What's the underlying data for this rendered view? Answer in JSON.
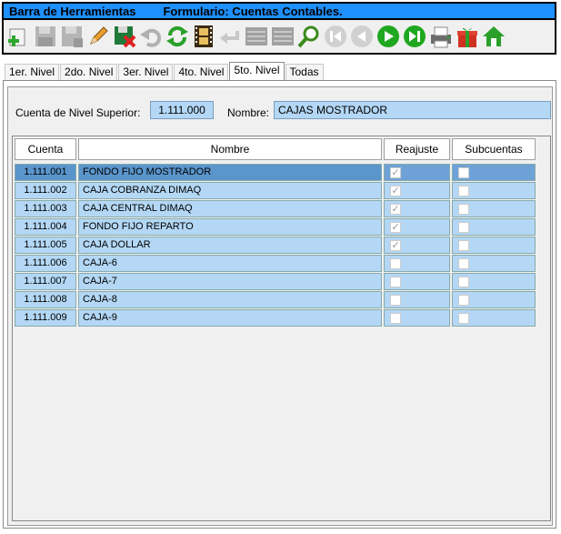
{
  "toolbar": {
    "title": "Barra de Herramientas",
    "subtitle": "Formulario: Cuentas Contables.",
    "buttons": [
      {
        "name": "add-icon"
      },
      {
        "name": "save-icon"
      },
      {
        "name": "save-as-icon"
      },
      {
        "name": "edit-icon"
      },
      {
        "name": "delete-icon"
      },
      {
        "name": "undo-icon"
      },
      {
        "name": "refresh-icon"
      },
      {
        "name": "film-icon"
      },
      {
        "name": "back-arrow-icon"
      },
      {
        "name": "list-icon"
      },
      {
        "name": "list-alt-icon"
      },
      {
        "name": "search-icon"
      },
      {
        "name": "first-icon"
      },
      {
        "name": "previous-icon"
      },
      {
        "name": "next-icon"
      },
      {
        "name": "last-icon"
      },
      {
        "name": "print-icon"
      },
      {
        "name": "gift-icon"
      },
      {
        "name": "home-icon"
      }
    ]
  },
  "tabs": [
    {
      "label": "1er. Nivel",
      "active": false
    },
    {
      "label": "2do. Nivel",
      "active": false
    },
    {
      "label": "3er. Nivel",
      "active": false
    },
    {
      "label": "4to. Nivel",
      "active": false
    },
    {
      "label": "5to. Nivel",
      "active": true
    },
    {
      "label": "Todas",
      "active": false
    }
  ],
  "form": {
    "parent_label": "Cuenta de Nivel Superior:",
    "parent_value": "1.111.000",
    "name_label": "Nombre:",
    "name_value": "CAJAS MOSTRADOR"
  },
  "grid": {
    "headers": [
      "Cuenta",
      "Nombre",
      "Reajuste",
      "Subcuentas"
    ],
    "rows": [
      {
        "cuenta": "1.111.001",
        "nombre": "FONDO FIJO MOSTRADOR",
        "reajuste": true,
        "subcuentas": false,
        "selected": true
      },
      {
        "cuenta": "1.111.002",
        "nombre": "CAJA COBRANZA DIMAQ",
        "reajuste": true,
        "subcuentas": false
      },
      {
        "cuenta": "1.111.003",
        "nombre": "CAJA CENTRAL DIMAQ",
        "reajuste": true,
        "subcuentas": false
      },
      {
        "cuenta": "1.111.004",
        "nombre": "FONDO FIJO REPARTO",
        "reajuste": true,
        "subcuentas": false
      },
      {
        "cuenta": "1.111.005",
        "nombre": "CAJA  DOLLAR",
        "reajuste": true,
        "subcuentas": false
      },
      {
        "cuenta": "1.111.006",
        "nombre": "CAJA-6",
        "reajuste": false,
        "subcuentas": false
      },
      {
        "cuenta": "1.111.007",
        "nombre": "CAJA-7",
        "reajuste": false,
        "subcuentas": false
      },
      {
        "cuenta": "1.111.008",
        "nombre": "CAJA-8",
        "reajuste": false,
        "subcuentas": false
      },
      {
        "cuenta": "1.111.009",
        "nombre": "CAJA-9",
        "reajuste": false,
        "subcuentas": false
      }
    ]
  },
  "colors": {
    "titlebar": "#1e90ff",
    "cell": "#b3d7f5",
    "selected": "#5a95cc"
  }
}
